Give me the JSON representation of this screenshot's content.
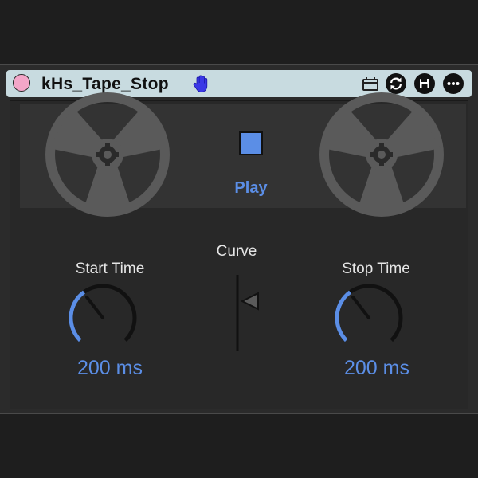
{
  "device": {
    "title": "kHs_Tape_Stop",
    "power_color": "#f3a6c8",
    "accent_color": "#5b8ee6",
    "titlebar_icons": [
      "hand-icon",
      "preset-icon",
      "sync-icon",
      "save-icon",
      "more-icon"
    ]
  },
  "transport": {
    "play_label": "Play",
    "play_active": true
  },
  "controls": {
    "start_time": {
      "label": "Start Time",
      "value": "200 ms"
    },
    "curve": {
      "label": "Curve"
    },
    "stop_time": {
      "label": "Stop Time",
      "value": "200 ms"
    }
  }
}
